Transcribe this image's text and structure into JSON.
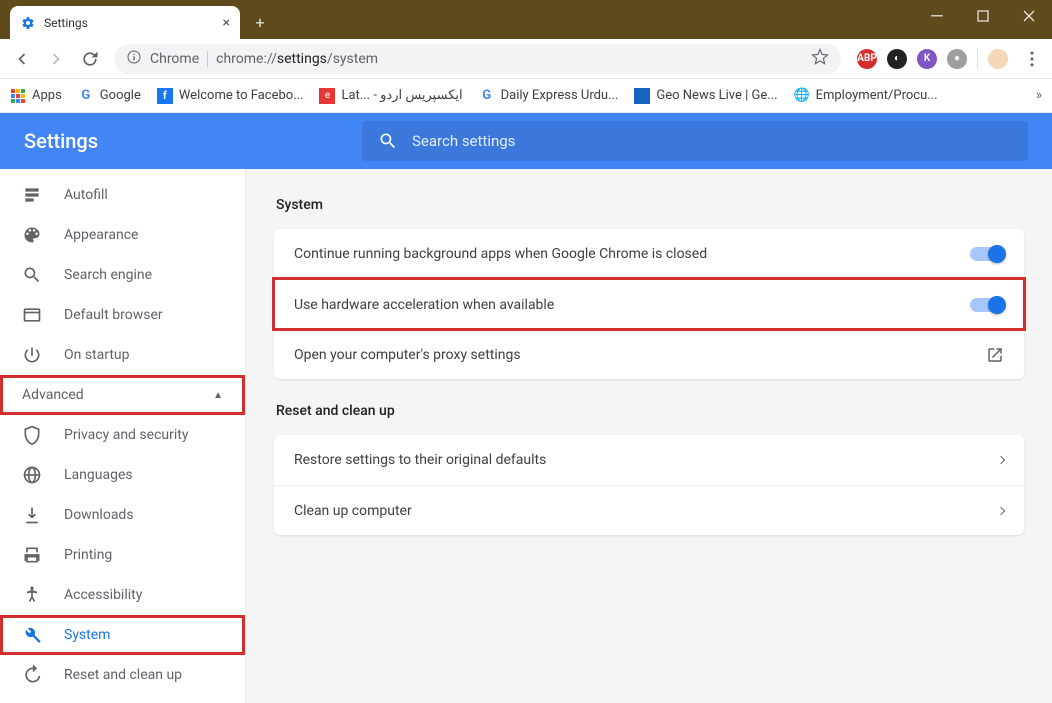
{
  "window": {
    "tab_title": "Settings"
  },
  "toolbar": {
    "chrome_label": "Chrome",
    "url_prefix": "chrome://",
    "url_bold": "settings",
    "url_suffix": "/system"
  },
  "bookmarks": {
    "apps": "Apps",
    "items": [
      "Google",
      "Welcome to Facebo...",
      "Lat... - ایکسپریس اردو",
      "Daily Express Urdu...",
      "Geo News Live | Ge...",
      "Employment/Procu..."
    ]
  },
  "header": {
    "title": "Settings",
    "search_placeholder": "Search settings"
  },
  "sidebar": {
    "items": [
      {
        "label": "Autofill"
      },
      {
        "label": "Appearance"
      },
      {
        "label": "Search engine"
      },
      {
        "label": "Default browser"
      },
      {
        "label": "On startup"
      }
    ],
    "advanced_label": "Advanced",
    "advanced_items": [
      {
        "label": "Privacy and security"
      },
      {
        "label": "Languages"
      },
      {
        "label": "Downloads"
      },
      {
        "label": "Printing"
      },
      {
        "label": "Accessibility"
      },
      {
        "label": "System"
      },
      {
        "label": "Reset and clean up"
      }
    ]
  },
  "main": {
    "system_title": "System",
    "row1": "Continue running background apps when Google Chrome is closed",
    "row2": "Use hardware acceleration when available",
    "row3": "Open your computer's proxy settings",
    "reset_title": "Reset and clean up",
    "reset_row1": "Restore settings to their original defaults",
    "reset_row2": "Clean up computer"
  }
}
